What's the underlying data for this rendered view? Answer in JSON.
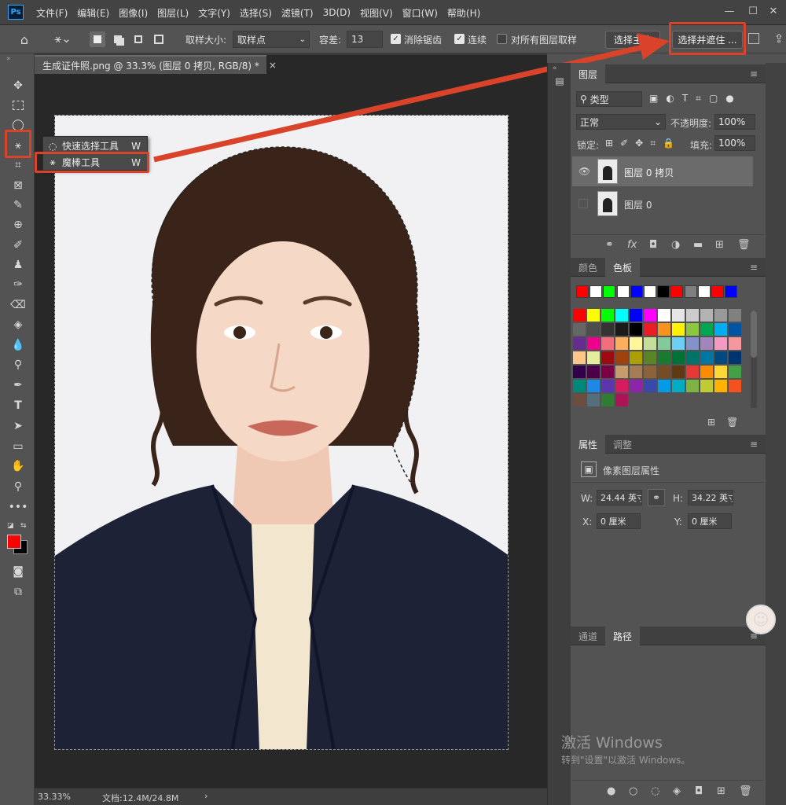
{
  "app": {
    "logo": "Ps",
    "menu": [
      "文件(F)",
      "编辑(E)",
      "图像(I)",
      "图层(L)",
      "文字(Y)",
      "选择(S)",
      "滤镜(T)",
      "3D(D)",
      "视图(V)",
      "窗口(W)",
      "帮助(H)"
    ]
  },
  "options": {
    "sample_size_label": "取样大小:",
    "sample_size_value": "取样点",
    "tolerance_label": "容差:",
    "tolerance_value": "13",
    "antialias_label": "消除锯齿",
    "contiguous_label": "连续",
    "sample_all_label": "对所有图层取样",
    "select_subject_label": "选择主体",
    "select_mask_label": "选择并遮住 ..."
  },
  "document": {
    "tab_title": "生成证件照.png @ 33.3% (图层 0 拷贝, RGB/8) *",
    "close": "×",
    "zoom": "33.33%",
    "doc_info": "文档:12.4M/24.8M"
  },
  "flyout": {
    "items": [
      {
        "label": "快速选择工具",
        "shortcut": "W"
      },
      {
        "label": "魔棒工具",
        "shortcut": "W"
      }
    ]
  },
  "layers_panel": {
    "tab": "图层",
    "filter_kind": "类型",
    "blend_mode": "正常",
    "opacity_label": "不透明度:",
    "opacity_value": "100%",
    "lock_label": "锁定:",
    "fill_label": "填充:",
    "fill_value": "100%",
    "layers": [
      {
        "name": "图层 0 拷贝",
        "visible": true,
        "selected": true
      },
      {
        "name": "图层 0",
        "visible": false,
        "selected": false
      }
    ]
  },
  "color_panel": {
    "tabs": [
      "颜色",
      "色板"
    ]
  },
  "properties_panel": {
    "tabs": [
      "属性",
      "调整"
    ],
    "title": "像素图层属性",
    "w_label": "W:",
    "w_value": "24.44 英寸",
    "h_label": "H:",
    "h_value": "34.22 英寸",
    "x_label": "X:",
    "x_value": "0 厘米",
    "y_label": "Y:",
    "y_value": "0 厘米"
  },
  "paths_panel": {
    "tabs": [
      "通道",
      "路径"
    ]
  },
  "watermark": {
    "line1": "激活 Windows",
    "line2": "转到\"设置\"以激活 Windows。"
  },
  "colors": {
    "accent_callout": "#d8432a",
    "foreground": "#ff0000",
    "background": "#000000"
  },
  "swatches": {
    "recent": [
      "#ff0000",
      "#ffffff",
      "#00ff00",
      "#ffffff",
      "#0000ff",
      "#ffffff",
      "#000000",
      "#ff0000",
      "#7f7f7f",
      "#ffffff",
      "#ff0000",
      "#0000ff"
    ],
    "grid": [
      "#ff0000",
      "#ffff00",
      "#00ff00",
      "#00ffff",
      "#0000ff",
      "#ff00ff",
      "#ffffff",
      "#e6e6e6",
      "#cccccc",
      "#b3b3b3",
      "#999999",
      "#808080",
      "#666666",
      "#4d4d4d",
      "#333333",
      "#1a1a1a",
      "#000000",
      "#ed1c24",
      "#f7941d",
      "#fff200",
      "#8dc63f",
      "#00a651",
      "#00aeef",
      "#0054a6",
      "#662d91",
      "#ec008c",
      "#f26d7d",
      "#fbaf5d",
      "#fff799",
      "#c4df9b",
      "#82ca9c",
      "#6dcff6",
      "#8393ca",
      "#a186be",
      "#f49ac1",
      "#f5989d",
      "#fdc68a",
      "#e6ee9c",
      "#9e0b0f",
      "#a0410d",
      "#aba000",
      "#598527",
      "#1a7b30",
      "#007236",
      "#00746b",
      "#0076a3",
      "#004a80",
      "#003471",
      "#32004b",
      "#4b0049",
      "#7b0046",
      "#c69c6d",
      "#a67c52",
      "#8c6239",
      "#754c24",
      "#603913",
      "#e53935",
      "#fb8c00",
      "#fdd835",
      "#43a047",
      "#00897b",
      "#1e88e5",
      "#5e35b1",
      "#d81b60",
      "#8e24aa",
      "#3949ab",
      "#039be5",
      "#00acc1",
      "#7cb342",
      "#c0ca33",
      "#ffb300",
      "#f4511e",
      "#6d4c41",
      "#546e7a",
      "#2e7d32",
      "#ad1457"
    ]
  }
}
